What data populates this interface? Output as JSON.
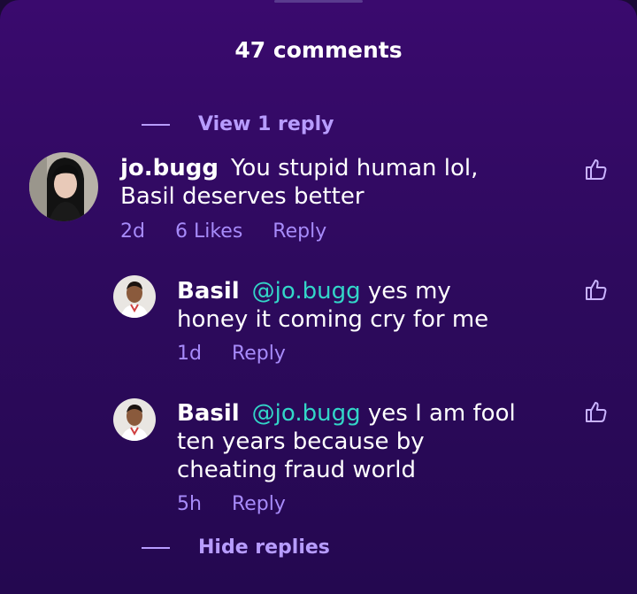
{
  "header": {
    "title": "47 comments"
  },
  "replies_toggle_top": {
    "label": "View 1 reply"
  },
  "comments": [
    {
      "username": "jo.bugg",
      "text": "You stupid human lol, Basil deserves better",
      "line1": "You stupid human lol,",
      "line2": "Basil deserves better",
      "time": "2d",
      "likes": "6 Likes",
      "reply_label": "Reply"
    }
  ],
  "replies": [
    {
      "username": "Basil",
      "mention": "@jo.bugg",
      "line1": "yes my",
      "line2": "honey it coming cry for me",
      "time": "1d",
      "reply_label": "Reply"
    },
    {
      "username": "Basil",
      "mention": "@jo.bugg",
      "line1": "yes I am fool",
      "line2": "ten years because by",
      "line3": "cheating fraud world",
      "time": "5h",
      "reply_label": "Reply"
    }
  ],
  "replies_toggle_bottom": {
    "label": "Hide replies"
  },
  "colors": {
    "accent": "#b79cff",
    "mention": "#33d6c8",
    "meta": "#a78bfa",
    "background": "#2e0a5e"
  }
}
